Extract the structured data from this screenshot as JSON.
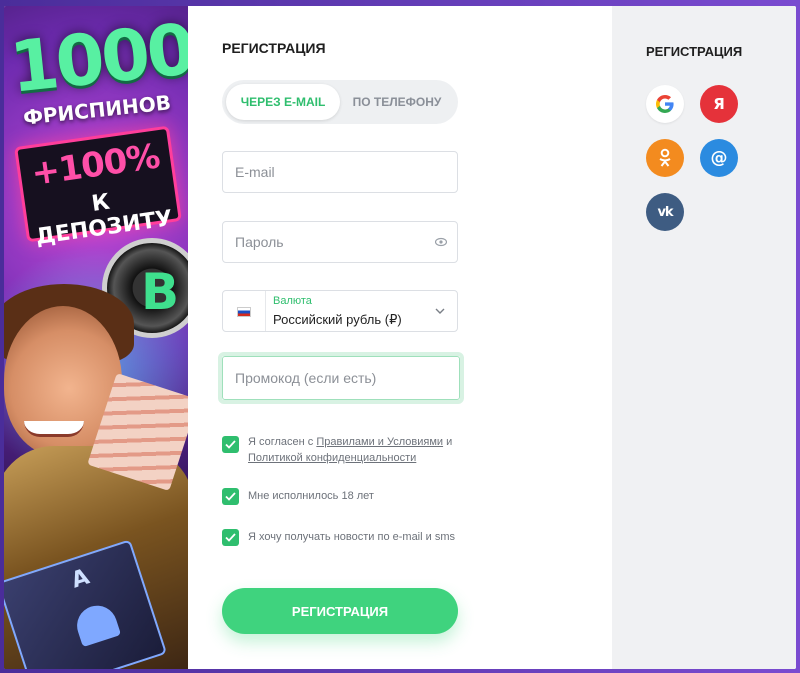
{
  "promo": {
    "line1": "1000",
    "line2": "ФРИСПИНОВ",
    "line3": "+100%",
    "line4": "К ДЕПОЗИТУ",
    "chip_letter": "B",
    "card_letter": "A"
  },
  "form": {
    "title": "РЕГИСТРАЦИЯ",
    "tabs": [
      {
        "label": "ЧЕРЕЗ E-MAIL",
        "active": true
      },
      {
        "label": "ПО ТЕЛЕФОНУ",
        "active": false
      }
    ],
    "email": {
      "placeholder": "E-mail",
      "value": ""
    },
    "password": {
      "placeholder": "Пароль",
      "value": ""
    },
    "currency": {
      "label": "Валюта",
      "value": "Российский рубль (₽)"
    },
    "promocode": {
      "placeholder": "Промокод (если есть)",
      "value": ""
    },
    "checkboxes": {
      "terms": {
        "checked": true,
        "prefix": "Я согласен с ",
        "link1": "Правилами и Условиями",
        "middle": " и ",
        "link2": "Политикой конфиденциальности"
      },
      "age": {
        "checked": true,
        "text": "Мне исполнилось 18 лет"
      },
      "news": {
        "checked": true,
        "text": "Я хочу получать новости по e-mail и sms"
      }
    },
    "submit_label": "РЕГИСТРАЦИЯ"
  },
  "social": {
    "title": "РЕГИСТРАЦИЯ",
    "buttons": [
      {
        "name": "google",
        "glyph": "G",
        "color": "#ffffff"
      },
      {
        "name": "yandex",
        "glyph": "Я",
        "color": "#e5323a"
      },
      {
        "name": "odnoklassniki",
        "glyph": "ok",
        "color": "#f38b1f"
      },
      {
        "name": "mail",
        "glyph": "@",
        "color": "#2b8be0"
      },
      {
        "name": "vk",
        "glyph": "vk",
        "color": "#3e5c82"
      }
    ]
  },
  "colors": {
    "accent": "#2fbe6e",
    "button": "#3fd37e",
    "frame": "#5b3aa8"
  }
}
